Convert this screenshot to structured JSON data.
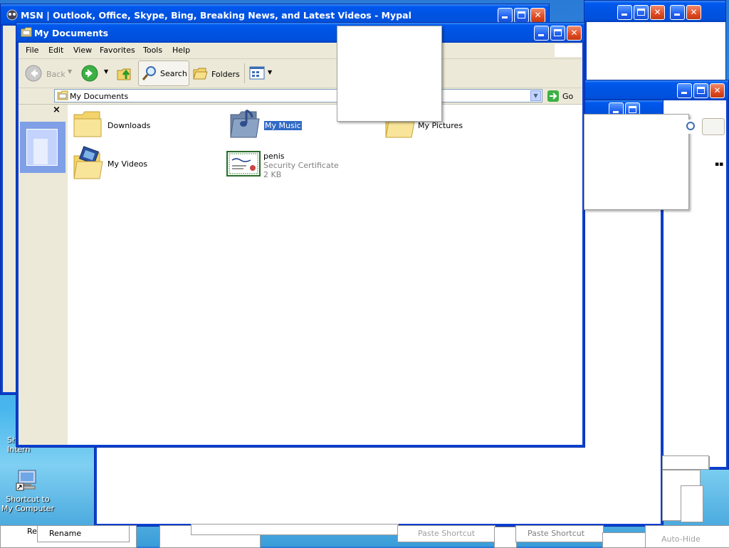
{
  "background_window": {
    "title": "MSN | Outlook, Office, Skype, Bing, Breaking News, and Latest Videos - Mypal"
  },
  "explorer": {
    "title": "My Documents",
    "menu": [
      "File",
      "Edit",
      "View",
      "Favorites",
      "Tools",
      "Help"
    ],
    "toolbar": {
      "back": "Back",
      "search": "Search",
      "folders": "Folders"
    },
    "address": {
      "value": "My Documents",
      "go": "Go"
    },
    "pane_close": "×",
    "items": [
      {
        "name": "Downloads",
        "type": "folder"
      },
      {
        "name": "My Music",
        "type": "music-folder",
        "selected": true
      },
      {
        "name": "My Pictures",
        "type": "pictures-folder"
      },
      {
        "name": "My Videos",
        "type": "videos-folder"
      },
      {
        "name": "penis",
        "type": "certificate",
        "detail": "Security Certificate",
        "size": "2 KB"
      }
    ]
  },
  "desktop": {
    "shortcut_partial": "Sh\nIntern",
    "shortcut_computer": "Shortcut to My Computer"
  },
  "context_menus": {
    "rename": "Rename",
    "rename_partial": "Re",
    "paste_shortcut_1": "Paste Shortcut",
    "paste_shortcut_2": "Paste Shortcut",
    "auto_hide": "Auto-Hide"
  },
  "colors": {
    "title_blue": "#0053e1",
    "selection": "#316ac5",
    "toolbar_bg": "#ece9d8"
  }
}
